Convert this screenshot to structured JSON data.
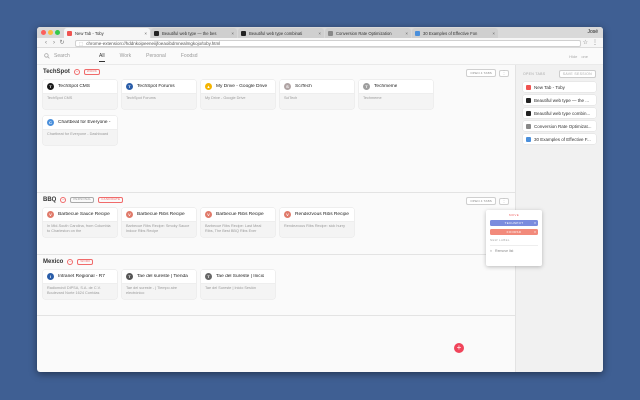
{
  "browser": {
    "tabs": [
      {
        "title": "New Tab - Toby",
        "color": "#ef5350",
        "active": true
      },
      {
        "title": "Beautiful web type — the bes",
        "color": "#222222"
      },
      {
        "title": "Beautiful web type combinati",
        "color": "#222222"
      },
      {
        "title": "Conversion Rate Optimization",
        "color": "#888888"
      },
      {
        "title": "30 Examples of Effective Fon",
        "color": "#4a8fdb"
      }
    ],
    "close_glyph": "×",
    "user": "José",
    "url": "chrome-extension://hddnkoipeeneiijfoeaoibdmnealmgkojo/toby.html"
  },
  "topbar": {
    "search_label": "Search",
    "filters": [
      "All",
      "Work",
      "Personal",
      "Foodsd"
    ],
    "active_filter": "All",
    "actions": [
      "Hide",
      "one"
    ]
  },
  "sections": [
    {
      "title": "TechSpot",
      "tags": [
        "WORK"
      ],
      "open_tabs_label": "OPEN 4 TABS",
      "cards": [
        {
          "title": "TechSpot CMS",
          "desc": "TechSpot CMS",
          "icon_color": "#1a1a1a",
          "icon_glyph": "T"
        },
        {
          "title": "TechSpot Forums",
          "desc": "TechSpot Forums",
          "icon_color": "#2a5da8",
          "icon_glyph": "T"
        },
        {
          "title": "My Drive - Google Drive",
          "desc": "My Drive - Google Drive",
          "icon_color": "#f4b400",
          "icon_glyph": "▲"
        },
        {
          "title": "SciTech",
          "desc": "SciTech",
          "icon_color": "#b0a4a4",
          "icon_glyph": "S"
        },
        {
          "title": "Techmeme",
          "desc": "Techmeme",
          "icon_color": "#9e9e9e",
          "icon_glyph": "T"
        },
        {
          "title": "Chartbeat for Everyone - ",
          "desc": "Chartbeat for Everyone - Dashboard",
          "icon_color": "#4a8fdb",
          "icon_glyph": "C"
        }
      ]
    },
    {
      "title": "BBQ",
      "tags": [
        "PERSONAL",
        "CANDIDATE"
      ],
      "open_tabs_label": "OPEN 4 TABS",
      "cards": [
        {
          "title": "Barbecue Sauce Recipe",
          "desc": "In Mid-South Carolina, from Columbia to Charleston on the",
          "icon_color": "#e07a6a",
          "icon_glyph": "V"
        },
        {
          "title": "Barbecue Ribs Recipe",
          "desc": "Barbecue Ribs Recipe: Smoky Sauce Indoor Ribs Recipe",
          "icon_color": "#e07a6a",
          "icon_glyph": "V"
        },
        {
          "title": "Barbecue Ribs Recipe",
          "desc": "Barbecue Ribs Recipe: Last Meal Ribs, The Best BBQ Ribs Ever",
          "icon_color": "#e07a6a",
          "icon_glyph": "V"
        },
        {
          "title": "Rendezvous Ribs Recipe",
          "desc": "Rendezvous Ribs Recipe: sick hurry",
          "icon_color": "#e07a6a",
          "icon_glyph": "V"
        }
      ]
    },
    {
      "title": "Mexico",
      "tags": [
        "WORK"
      ],
      "open_tabs_label": "",
      "cards": [
        {
          "title": "Intranet Regional - R7",
          "desc": "Radiomóvil DIPSA, S.A. de C.V. Boulevard Norte 1624 Corridas",
          "icon_color": "#2a5da8",
          "icon_glyph": "I"
        },
        {
          "title": "Tae del sureste | Tienda",
          "desc": "Tae del sureste - | Tiempo aire electrónico",
          "icon_color": "#555555",
          "icon_glyph": "T"
        },
        {
          "title": "Tae del Sureste | Inicio",
          "desc": "Tae del Sureste | Inicio Sesión",
          "icon_color": "#666666",
          "icon_glyph": "T"
        }
      ]
    }
  ],
  "menu": {
    "move_label": "MOVE",
    "options": [
      "TECHSPOT",
      "FOODSD"
    ],
    "new_label": "NEW LABEL",
    "remove_label": "Remove list"
  },
  "sidebar": {
    "title": "OPEN TABS",
    "save_label": "SAVE SESSION",
    "items": [
      {
        "label": "New Tab - Toby",
        "color": "#ef5350"
      },
      {
        "label": "Beautiful web type — the ...",
        "color": "#222222"
      },
      {
        "label": "Beautiful web type combin...",
        "color": "#222222"
      },
      {
        "label": "Conversion Rate Optimizat...",
        "color": "#888888"
      },
      {
        "label": "30 Examples of Effective F...",
        "color": "#4a8fdb"
      }
    ]
  },
  "fab_glyph": "+",
  "colors": {
    "accent": "#f06a6a",
    "fab": "#f0445a",
    "menu_blue": "#7b8cde",
    "menu_red": "#f28a7b"
  }
}
